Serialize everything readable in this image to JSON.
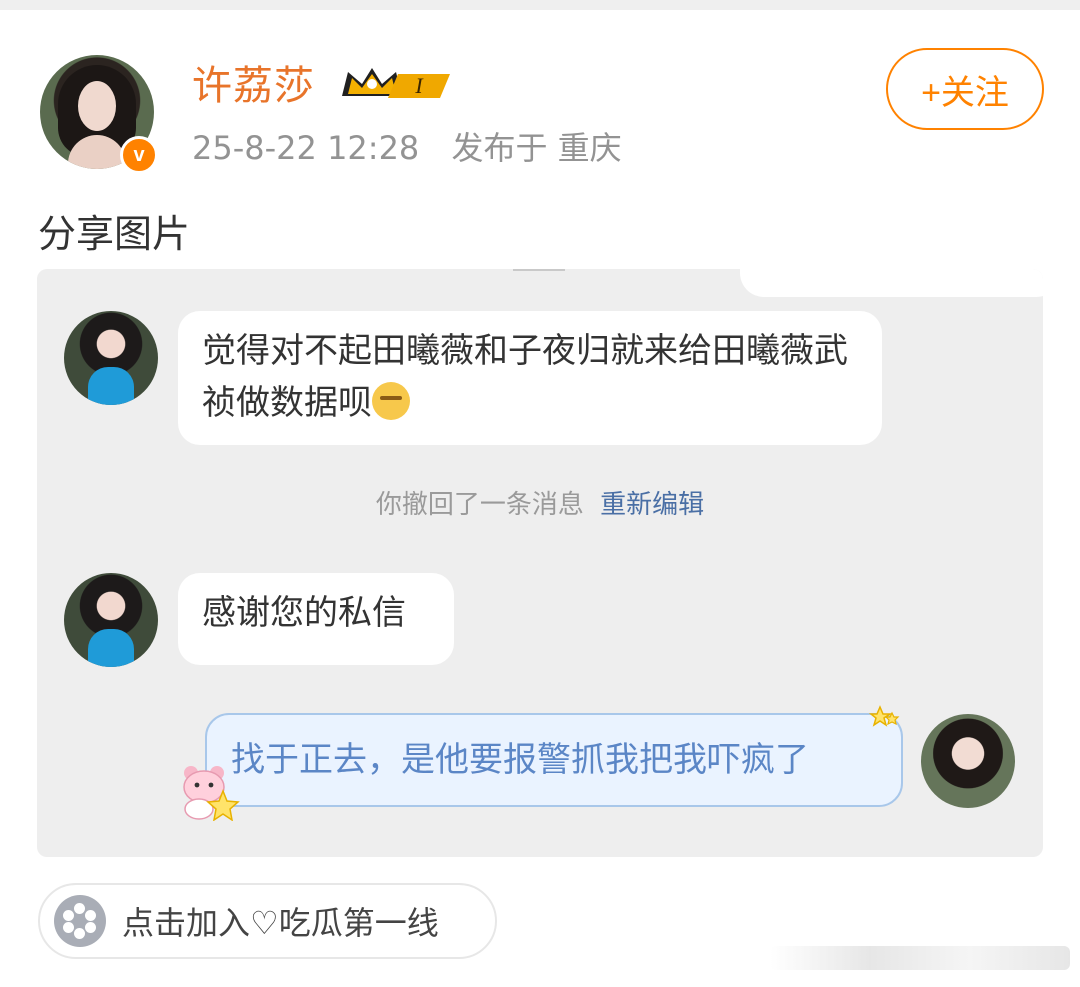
{
  "post": {
    "username": "许荔莎",
    "vip_label": "I",
    "time": "25-8-22 12:28",
    "location": "发布于 重庆",
    "follow_label": "+关注",
    "text": "分享图片"
  },
  "chat": {
    "message1": "觉得对不起田曦薇和子夜归就来给田曦薇武祯做数据呗",
    "system": "你撤回了一条消息",
    "system_link": "重新编辑",
    "message2": "感谢您的私信",
    "message3": "找于正去，是他要报警抓我把我吓疯了"
  },
  "group": {
    "label": "点击加入♡吃瓜第一线"
  },
  "colors": {
    "accent": "#ff8200",
    "username": "#e8742a",
    "link": "#4a6fa5",
    "my_bubble_text": "#5b86c6"
  }
}
